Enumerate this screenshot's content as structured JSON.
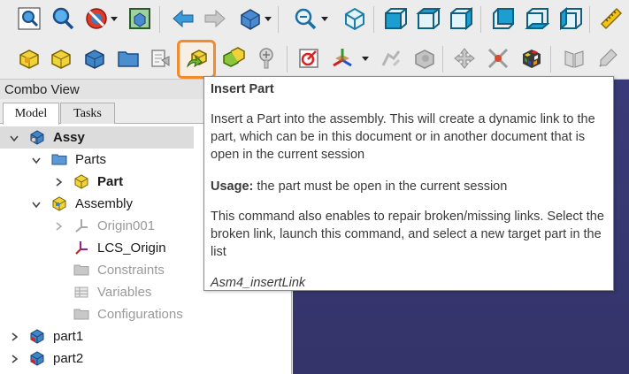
{
  "toolbar1": {
    "buttons": [
      "fit-all",
      "fit-selection",
      "draw-style",
      "bounding-box",
      "back",
      "forward",
      "std-views",
      "zoom",
      "isometric",
      "front",
      "top",
      "right",
      "rear",
      "bottom",
      "left",
      "measure"
    ]
  },
  "toolbar2": {
    "buttons": [
      "new-assembly",
      "new-part",
      "new-body",
      "new-group",
      "import-datum",
      "insert-part",
      "insert-part-alt",
      "screw",
      "add-sketch",
      "add-datum",
      "release-placement",
      "attach-part",
      "move-part",
      "explode",
      "solver",
      "assembly-info",
      "measure-tool"
    ],
    "highlighted": "insert-part"
  },
  "combo": {
    "title": "Combo View",
    "tabs": [
      "Model",
      "Tasks"
    ],
    "active_tab": "Model"
  },
  "tree": [
    {
      "label": "Assy",
      "depth": 0,
      "expanded": true,
      "icon": "assembly-icon",
      "selected": true,
      "bold": true
    },
    {
      "label": "Parts",
      "depth": 1,
      "expanded": true,
      "icon": "folder-icon"
    },
    {
      "label": "Part",
      "depth": 2,
      "expanded": false,
      "icon": "part-icon",
      "bold": true
    },
    {
      "label": "Assembly",
      "depth": 1,
      "expanded": true,
      "icon": "assembly-yellow-icon"
    },
    {
      "label": "Origin001",
      "depth": 2,
      "expanded": false,
      "icon": "origin-icon",
      "grey": true
    },
    {
      "label": "LCS_Origin",
      "depth": 2,
      "icon": "lcs-icon"
    },
    {
      "label": "Constraints",
      "depth": 2,
      "icon": "folder-grey-icon",
      "grey": true
    },
    {
      "label": "Variables",
      "depth": 2,
      "icon": "variables-icon",
      "grey": true
    },
    {
      "label": "Configurations",
      "depth": 2,
      "icon": "folder-grey-icon",
      "grey": true
    },
    {
      "label": "part1",
      "depth": 0,
      "expanded": false,
      "icon": "part-doc-icon"
    },
    {
      "label": "part2",
      "depth": 0,
      "expanded": false,
      "icon": "part-doc-icon"
    }
  ],
  "tooltip": {
    "title": "Insert Part",
    "description": "Insert a Part into the assembly. This will create a dynamic link to the part, which can be in this document or in another document that is open in the current session",
    "usage_label": "Usage:",
    "usage_text": " the part must be open in the current session",
    "repair": "This command also enables to repair broken/missing links. Select the broken link, launch this command, and select a new target part in the list",
    "command": "Asm4_insertLink"
  },
  "colors": {
    "highlight": "#f28a2e",
    "viewport": "#3a3a78",
    "accent_blue": "#3f86c8",
    "accent_yellow": "#e8c21a",
    "accent_green": "#7fb832"
  }
}
